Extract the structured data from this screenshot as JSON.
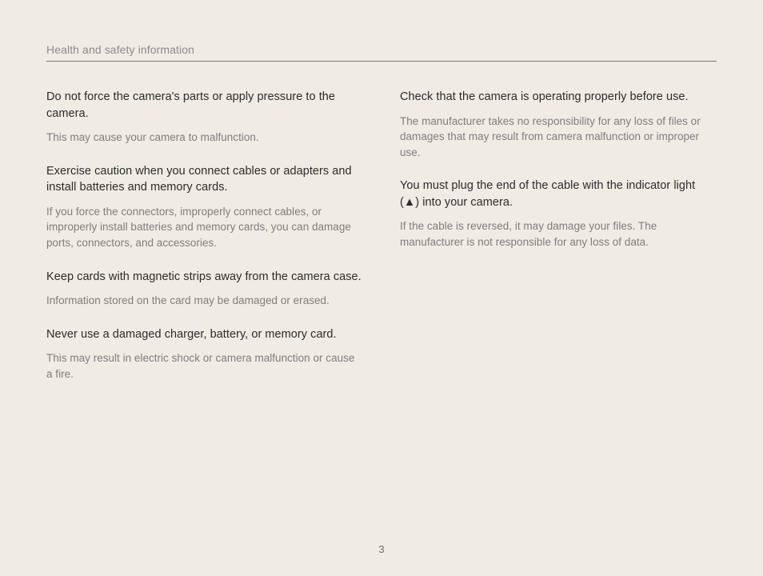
{
  "header": {
    "title": "Health and safety information"
  },
  "left": {
    "b1": {
      "h": "Do not force the camera's parts or apply pressure to the camera.",
      "p": "This may cause your camera to malfunction."
    },
    "b2": {
      "h": "Exercise caution when you connect cables or adapters and install batteries and memory cards.",
      "p": "If you force the connectors, improperly connect cables, or improperly install batteries and memory cards, you can damage ports, connectors, and accessories."
    },
    "b3": {
      "h": "Keep cards with magnetic strips away from the camera case.",
      "p": "Information stored on the card may be damaged or erased."
    },
    "b4": {
      "h": "Never use a damaged charger, battery, or memory card.",
      "p": "This may result in electric shock or camera malfunction or cause a fire."
    }
  },
  "right": {
    "b1": {
      "h": "Check that the camera is operating properly before use.",
      "p": "The manufacturer takes no responsibility for any loss of files or damages that may result from camera malfunction or improper use."
    },
    "b2": {
      "h": "You must plug the end of the cable with the indicator light (▲) into your camera.",
      "p": "If the cable is reversed, it may damage your files. The manufacturer is not responsible for any loss of data."
    }
  },
  "page_number": "3"
}
